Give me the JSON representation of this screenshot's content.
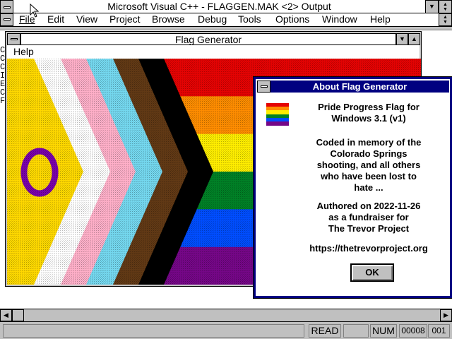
{
  "app": {
    "title": "Microsoft Visual C++ - FLAGGEN.MAK <2> Output",
    "menu": [
      {
        "label": "File",
        "name": "menu-file"
      },
      {
        "label": "Edit",
        "name": "menu-edit"
      },
      {
        "label": "View",
        "name": "menu-view"
      },
      {
        "label": "Project",
        "name": "menu-project"
      },
      {
        "label": "Browse",
        "name": "menu-browse"
      },
      {
        "label": "Debug",
        "name": "menu-debug"
      },
      {
        "label": "Tools",
        "name": "menu-tools"
      },
      {
        "label": "Options",
        "name": "menu-options"
      },
      {
        "label": "Window",
        "name": "menu-window"
      },
      {
        "label": "Help",
        "name": "menu-help"
      }
    ],
    "output_fragments": [
      "C",
      "C",
      "C",
      "I",
      "E",
      "C",
      "F"
    ]
  },
  "flag_window": {
    "title": "Flag Generator",
    "menu_help": "Help",
    "stripes": [
      "#e40303",
      "#ff8c00",
      "#ffed00",
      "#008026",
      "#004dff",
      "#750787"
    ],
    "chevrons": [
      "#000000",
      "#613915",
      "#74d7ee",
      "#ffafc8",
      "#ffffff"
    ],
    "intersex_yellow": "#ffd800",
    "intersex_ring": "#7902aa"
  },
  "about_dialog": {
    "title": "About Flag Generator",
    "heading_line1": "Pride Progress Flag for",
    "heading_line2": "Windows 3.1 (v1)",
    "memo_line1": "Coded in memory of the",
    "memo_line2": "Colorado Springs",
    "memo_line3": "shooting, and all others",
    "memo_line4": "who have been lost to",
    "memo_line5": "hate ...",
    "authored_line1": "Authored on 2022-11-26",
    "authored_line2": "as a fundraiser for",
    "authored_line3": "The Trevor Project",
    "url": "https://thetrevorproject.org",
    "ok_label": "OK"
  },
  "status": {
    "mode": "READ",
    "num": "NUM",
    "line": "00008",
    "col": "001"
  }
}
